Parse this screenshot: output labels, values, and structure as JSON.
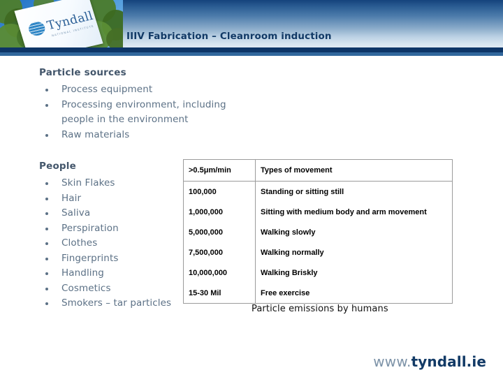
{
  "header": {
    "title": "IIIV Fabrication – Cleanroom induction",
    "logo": {
      "name": "tyndall-logo-photo",
      "wordmark": "Tyndall",
      "subtext": "NATIONAL INSTITUTE"
    },
    "colors": {
      "gradient_top": "#15437c",
      "gradient_bottom": "#dfe9f3",
      "rule_dark": "#0d3567",
      "rule_mid": "#31679c",
      "title_color": "#123a66"
    }
  },
  "body": {
    "sections": [
      {
        "heading": "Particle sources",
        "items": [
          "Process equipment",
          "Processing environment, including people in the environment",
          "Raw materials"
        ]
      },
      {
        "heading": "People",
        "items": [
          "Skin Flakes",
          "Hair",
          "Saliva",
          "Perspiration",
          "Clothes",
          "Fingerprints",
          "Handling",
          "Cosmetics",
          "Smokers – tar particles"
        ]
      }
    ],
    "text_color": "#5c7186",
    "heading_color": "#43566b"
  },
  "table": {
    "caption": "Particle emissions by humans",
    "headers": [
      ">0.5μm/min",
      "Types of movement"
    ],
    "rows": [
      [
        "100,000",
        "Standing or sitting still"
      ],
      [
        "1,000,000",
        "Sitting with medium body and arm movement"
      ],
      [
        "5,000,000",
        "Walking slowly"
      ],
      [
        "7,500,000",
        "Walking normally"
      ],
      [
        "10,000,000",
        "Walking Briskly"
      ],
      [
        "15-30 Mil",
        "Free exercise"
      ]
    ],
    "border_color": "#9b9b9b"
  },
  "footer": {
    "url_prefix": "www.",
    "url_domain": "tyndall.ie"
  }
}
